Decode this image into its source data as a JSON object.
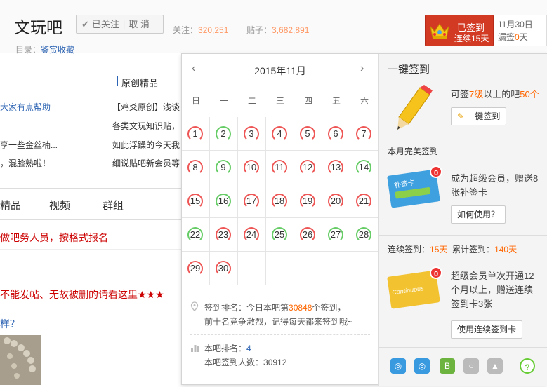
{
  "forum": {
    "name": "文玩吧",
    "follow_label": "已关注",
    "cancel_label": "取 消",
    "follow_count_label": "关注：",
    "follow_count": "320,251",
    "post_count_label": "贴子：",
    "post_count": "3,682,891",
    "dir_label": "目录：",
    "dir_value": "鉴赏收藏"
  },
  "sign": {
    "signed_label": "已签到",
    "streak_label": "连续15天",
    "date": "11月30日",
    "missed_prefix": "漏签",
    "missed_value": "0",
    "missed_suffix": "天"
  },
  "left": {
    "section_title": "原创精品",
    "left_items": [
      "大家有点帮助",
      "享一些金丝楠...",
      "，混脸熟啦！"
    ],
    "right_items": [
      "【鸡爻原创】浅谈",
      "各类文玩知识贴，",
      "如此浮躁的今天我",
      "细说贴吧新会员等"
    ],
    "nav": [
      "精品",
      "视频",
      "群组"
    ],
    "threads": [
      "做吧务人员，按格式报名",
      "不能发帖、无故被删的请看这里★★★",
      "样？"
    ]
  },
  "calendar": {
    "title": "2015年11月",
    "weekdays": [
      "日",
      "一",
      "二",
      "三",
      "四",
      "五",
      "六"
    ],
    "days": [
      {
        "n": "1",
        "c": "r"
      },
      {
        "n": "2",
        "c": "g"
      },
      {
        "n": "3",
        "c": "r"
      },
      {
        "n": "4",
        "c": "r"
      },
      {
        "n": "5",
        "c": "r"
      },
      {
        "n": "6",
        "c": "r"
      },
      {
        "n": "7",
        "c": "r"
      },
      {
        "n": "8",
        "c": "r"
      },
      {
        "n": "9",
        "c": "g"
      },
      {
        "n": "10",
        "c": "r"
      },
      {
        "n": "11",
        "c": "r"
      },
      {
        "n": "12",
        "c": "r"
      },
      {
        "n": "13",
        "c": "r"
      },
      {
        "n": "14",
        "c": "g"
      },
      {
        "n": "15",
        "c": "r"
      },
      {
        "n": "16",
        "c": "g"
      },
      {
        "n": "17",
        "c": "r"
      },
      {
        "n": "18",
        "c": "r"
      },
      {
        "n": "19",
        "c": "r"
      },
      {
        "n": "20",
        "c": "r"
      },
      {
        "n": "21",
        "c": "r"
      },
      {
        "n": "22",
        "c": "g"
      },
      {
        "n": "23",
        "c": "r"
      },
      {
        "n": "24",
        "c": "r"
      },
      {
        "n": "25",
        "c": "g"
      },
      {
        "n": "26",
        "c": "r"
      },
      {
        "n": "27",
        "c": "g"
      },
      {
        "n": "28",
        "c": "g"
      },
      {
        "n": "29",
        "c": "r"
      },
      {
        "n": "30",
        "c": "r"
      }
    ],
    "rank_prefix": "签到排名：今日本吧第",
    "rank_num": "30848",
    "rank_suffix": "个签到，",
    "rank_line2": "前十名竞争激烈，记得每天都来签到哦~",
    "bar_rank_label": "本吧排名：",
    "bar_rank": "4",
    "bar_count_label": "本吧签到人数：",
    "bar_count": "30912"
  },
  "panel": {
    "onekey_title": "一键签到",
    "onekey_desc_a": "可签",
    "onekey_desc_b": "7级",
    "onekey_desc_c": "以上的吧",
    "onekey_desc_d": "50个",
    "onekey_btn": "一键签到",
    "perfect_title": "本月完美签到",
    "perfect_desc1": "成为超级会员，赠送8",
    "perfect_desc2": "张补签卡",
    "perfect_btn": "如何使用？",
    "streak_label": "连续签到：",
    "streak_val": "15天",
    "total_label": "累计签到：",
    "total_val": "140天",
    "super_desc1": "超级会员单次开通12",
    "super_desc2": "个月以上，赠送连续",
    "super_desc3": "签到卡3张",
    "super_btn": "使用连续签到卡",
    "card_badge": "0",
    "card1_text": "补签卡",
    "card2_text": "Continuous"
  },
  "colors": {
    "accent": "#d23a24",
    "link": "#2d64b3",
    "orange": "#ff6600"
  }
}
